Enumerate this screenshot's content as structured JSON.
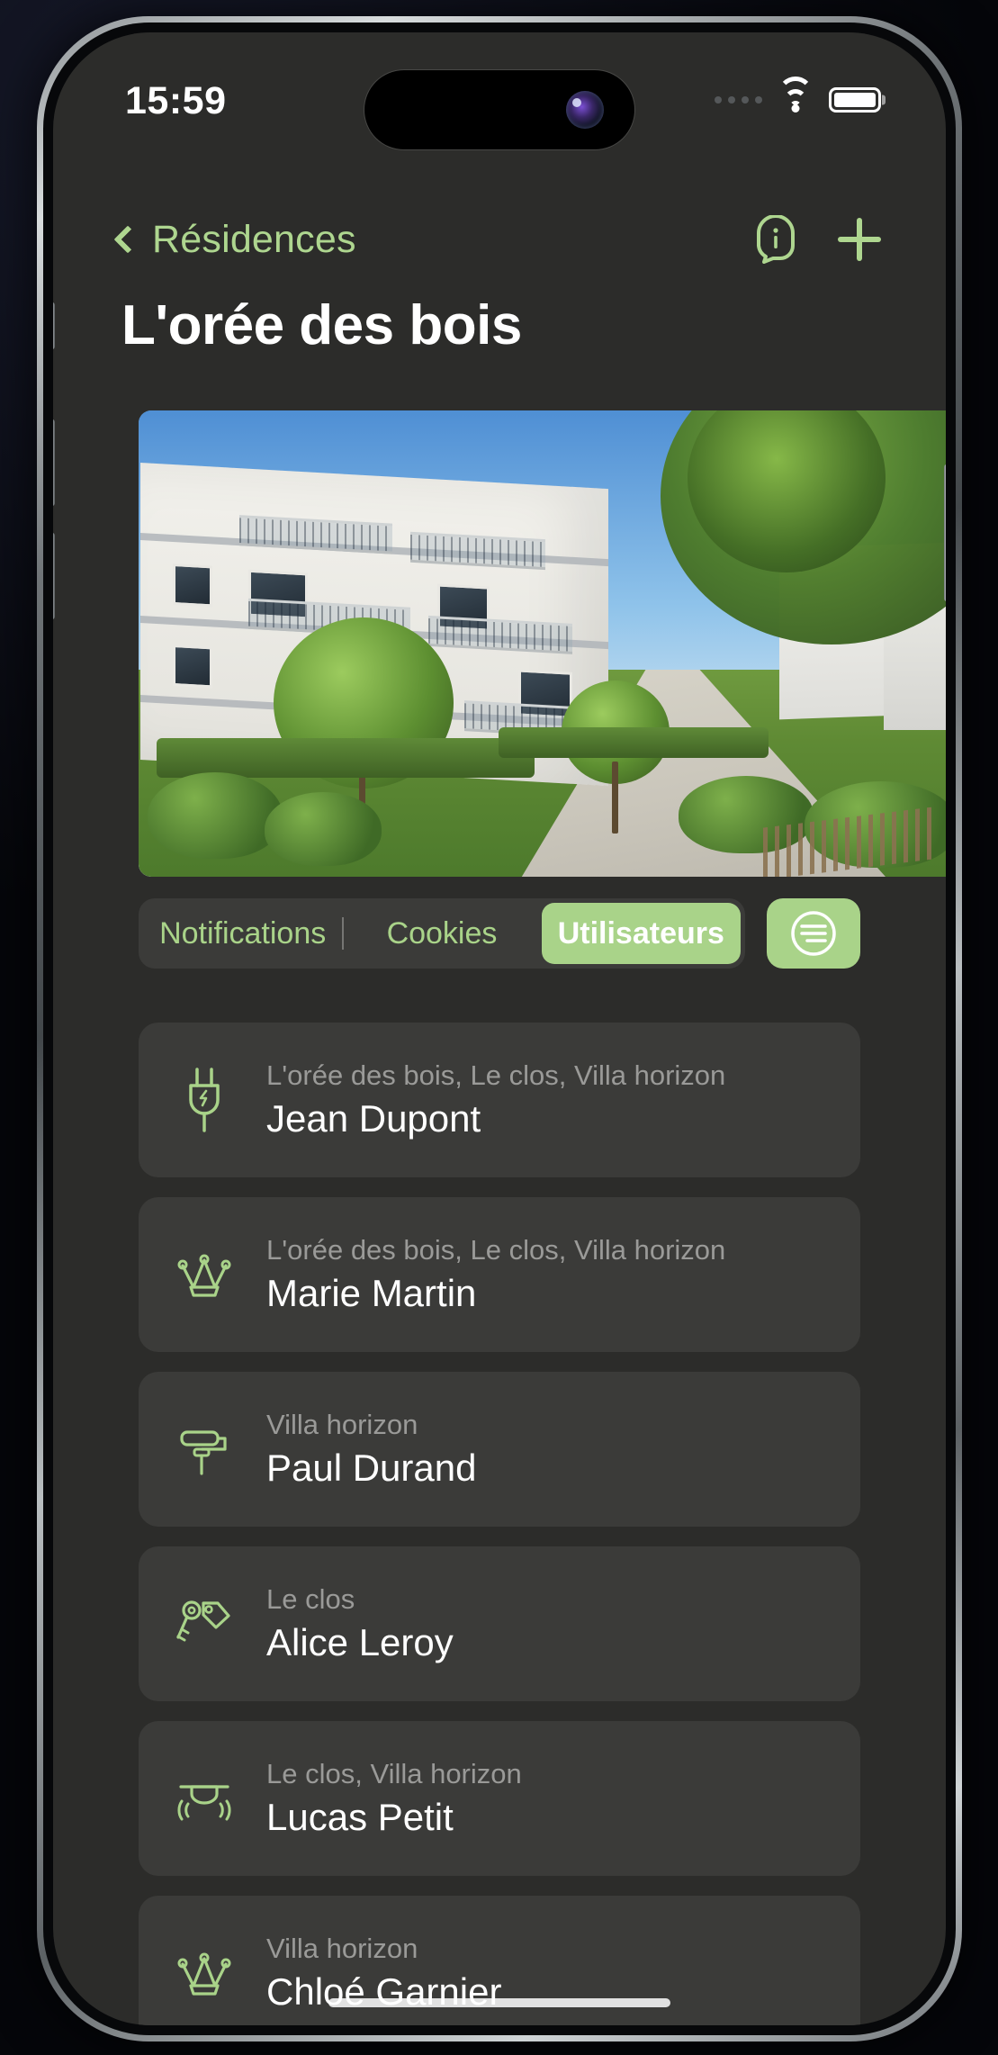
{
  "status_bar": {
    "time": "15:59",
    "wifi_icon": "wifi-icon",
    "battery_icon": "battery-icon",
    "signal_icon": "cellular-dots-icon"
  },
  "nav": {
    "back_label": "Résidences",
    "back_icon": "chevron-left-icon",
    "info_icon": "info-icon",
    "add_icon": "plus-icon"
  },
  "page_title": "L'orée des bois",
  "hero": {
    "alt": "residence-photo"
  },
  "segmented": {
    "tabs": [
      {
        "label": "Notifications",
        "active": false
      },
      {
        "label": "Cookies",
        "active": false
      },
      {
        "label": "Utilisateurs",
        "active": true
      }
    ],
    "filter_icon": "filter-lines-icon"
  },
  "users": [
    {
      "residences": "L'orée des bois, Le clos, Villa horizon",
      "name": "Jean Dupont",
      "icon": "plug-icon"
    },
    {
      "residences": "L'orée des bois, Le clos, Villa horizon",
      "name": "Marie Martin",
      "icon": "crown-icon"
    },
    {
      "residences": "Villa horizon",
      "name": "Paul Durand",
      "icon": "paint-roller-icon"
    },
    {
      "residences": "Le clos",
      "name": "Alice Leroy",
      "icon": "key-tag-icon"
    },
    {
      "residences": "Le clos, Villa horizon",
      "name": "Lucas Petit",
      "icon": "motion-sensor-icon"
    },
    {
      "residences": "Villa horizon",
      "name": "Chloé Garnier",
      "icon": "crown-icon"
    }
  ],
  "colors": {
    "accent_green": "#a9d389",
    "screen_bg": "#2c2c2a",
    "card_bg": "#3b3b39",
    "subtitle_gray": "#9a9a98"
  }
}
